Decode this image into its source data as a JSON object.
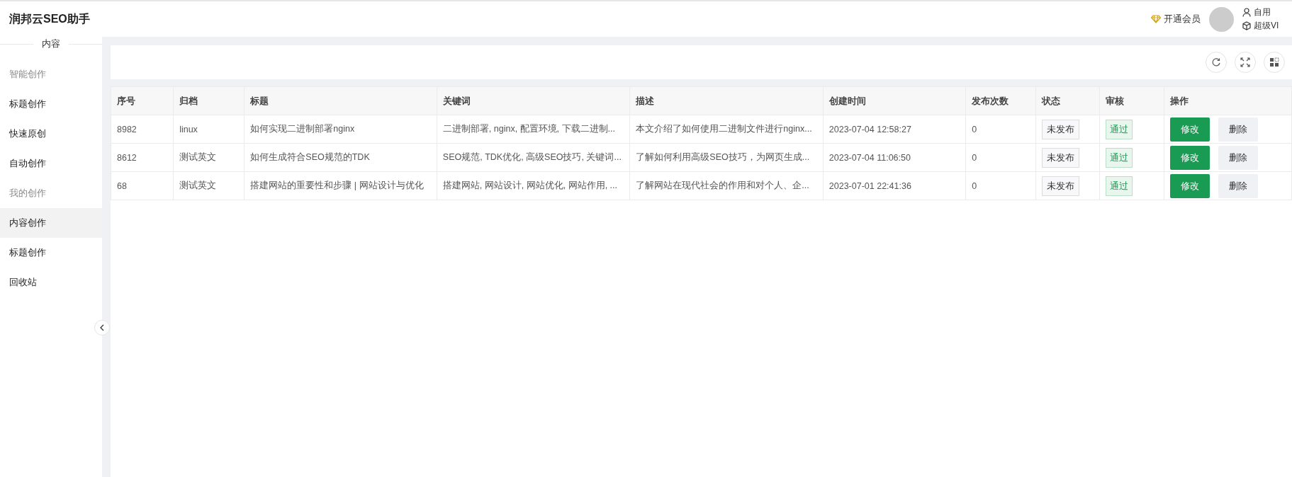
{
  "header": {
    "title": "润邦云SEO助手",
    "vip_link": "开通会员",
    "user_name": "自用",
    "user_level": "超级VI"
  },
  "sidebar": {
    "heading": "内容",
    "items": [
      {
        "kind": "group",
        "label": "智能创作",
        "selected": false
      },
      {
        "kind": "item",
        "label": "标题创作",
        "selected": false
      },
      {
        "kind": "item",
        "label": "快速原创",
        "selected": false
      },
      {
        "kind": "item",
        "label": "自动创作",
        "selected": false
      },
      {
        "kind": "group",
        "label": "我的创作",
        "selected": false
      },
      {
        "kind": "item",
        "label": "内容创作",
        "selected": true
      },
      {
        "kind": "item",
        "label": "标题创作",
        "selected": false
      },
      {
        "kind": "item",
        "label": "回收站",
        "selected": false
      }
    ]
  },
  "table": {
    "columns": [
      "序号",
      "归档",
      "标题",
      "关键词",
      "描述",
      "创建时间",
      "发布次数",
      "状态",
      "审核",
      "操作"
    ],
    "rows": [
      {
        "id": "8982",
        "archive": "linux",
        "title": "如何实现二进制部署nginx",
        "keywords": "二进制部署, nginx, 配置环境, 下载二进制...",
        "description": "本文介绍了如何使用二进制文件进行nginx...",
        "created": "2023-07-04 12:58:27",
        "publish_count": "0",
        "status": "未发布",
        "review": "通过",
        "actions": [
          "修改",
          "删除"
        ]
      },
      {
        "id": "8612",
        "archive": "测试英文",
        "title": "如何生成符合SEO规范的TDK",
        "keywords": "SEO规范, TDK优化, 高级SEO技巧, 关键词...",
        "description": "了解如何利用高级SEO技巧，为网页生成...",
        "created": "2023-07-04 11:06:50",
        "publish_count": "0",
        "status": "未发布",
        "review": "通过",
        "actions": [
          "修改",
          "删除"
        ]
      },
      {
        "id": "68",
        "archive": "测试英文",
        "title": "搭建网站的重要性和步骤 | 网站设计与优化",
        "keywords": "搭建网站, 网站设计, 网站优化, 网站作用, ...",
        "description": "了解网站在现代社会的作用和对个人、企...",
        "created": "2023-07-01 22:41:36",
        "publish_count": "0",
        "status": "未发布",
        "review": "通过",
        "actions": [
          "修改",
          "删除"
        ]
      }
    ]
  }
}
